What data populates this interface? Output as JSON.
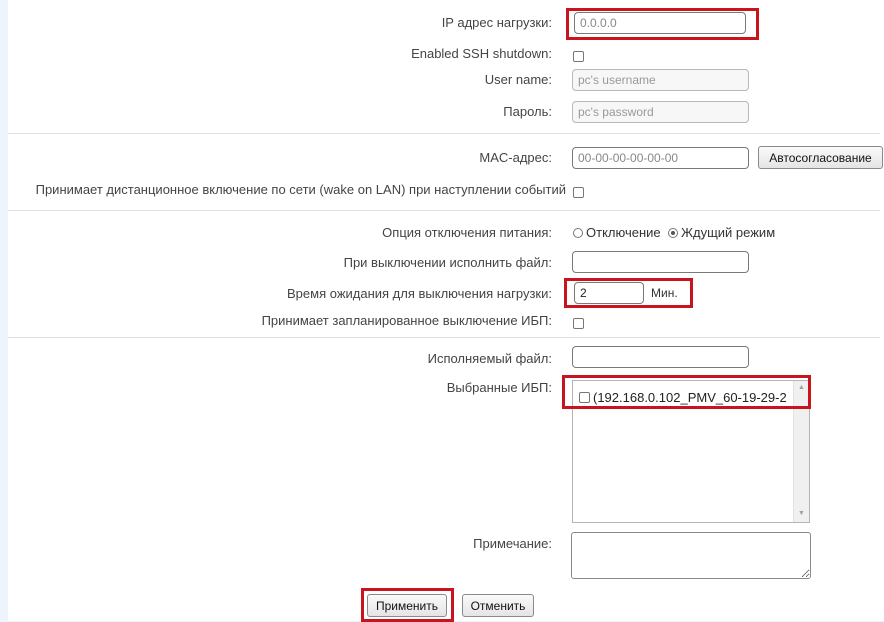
{
  "form": {
    "ip": {
      "label": "IP адрес нагрузки:",
      "value": "0.0.0.0"
    },
    "ssh": {
      "label": "Enabled SSH shutdown:"
    },
    "username": {
      "label": "User name:",
      "placeholder": "pc's username"
    },
    "password": {
      "label": "Пароль:",
      "placeholder": "pc's password"
    },
    "mac": {
      "label": "MAC-адрес:",
      "value": "00-00-00-00-00-00",
      "button": "Автосогласование"
    },
    "wol": {
      "label": "Принимает дистанционное включение по сети (wake on LAN) при наступлении событий"
    },
    "power_option": {
      "label": "Опция отключения питания:",
      "options": [
        "Отключение",
        "Ждущий режим"
      ],
      "selected": "Ждущий режим"
    },
    "exec_on_shutdown": {
      "label": "При выключении исполнить файл:",
      "value": ""
    },
    "wait_time": {
      "label": "Время ожидания для выключения нагрузки:",
      "value": "2",
      "unit": "Мин."
    },
    "scheduled": {
      "label": "Принимает запланированное выключение ИБП:"
    },
    "exec_file": {
      "label": "Исполняемый файл:",
      "value": ""
    },
    "ups": {
      "label": "Выбранные ИБП:",
      "items": [
        "(192.168.0.102_PMV_60-19-29-2"
      ]
    },
    "note": {
      "label": "Примечание:"
    }
  },
  "buttons": {
    "apply": "Применить",
    "cancel": "Отменить"
  },
  "colors": {
    "highlight": "#c8141e",
    "background": "#eef4fb"
  }
}
